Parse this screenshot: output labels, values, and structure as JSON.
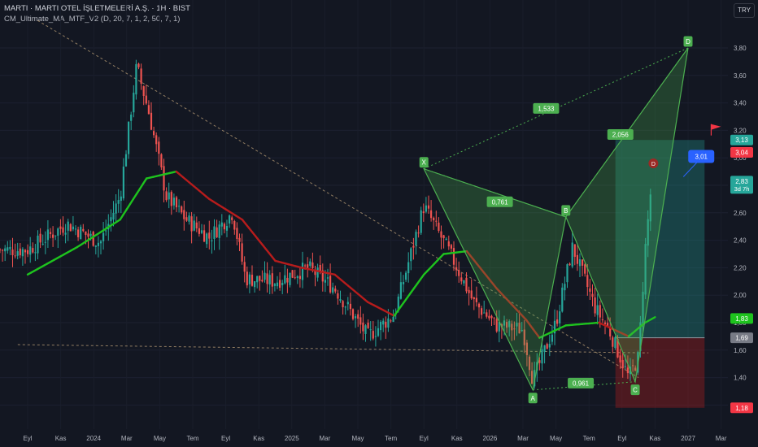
{
  "header": {
    "title": "MARTI · MARTI OTEL İŞLETMELERİ A.Ş. · 1H · BIST",
    "indicator": "CM_Ultimate_MA_MTF_V2 (D, 20, 7, 1, 2, 50, 7, 1)"
  },
  "currency_button": "TRY",
  "colors": {
    "background": "#131722",
    "bull": "#26a69a",
    "bear": "#ef5350",
    "ma_up": "#1ec31e",
    "ma_down": "#b71c1c",
    "pattern": "#4caf50",
    "target_box": "#26a69a",
    "stop_box": "#b71c1c"
  },
  "chart_data": {
    "type": "candlestick",
    "y_axis": {
      "ticks": [
        "3,80",
        "3,60",
        "3,40",
        "3,20",
        "3,00",
        "2,80",
        "2,60",
        "2,40",
        "2,20",
        "2,00",
        "1,80",
        "1,60",
        "1,40",
        "1,20"
      ],
      "range": [
        1.12,
        3.92
      ]
    },
    "x_axis": {
      "labels": [
        "Eyl",
        "Kas",
        "2024",
        "Mar",
        "May",
        "Tem",
        "Eyl",
        "Kas",
        "2025",
        "Mar",
        "May",
        "Tem",
        "Eyl",
        "Kas",
        "2026",
        "Mar",
        "May",
        "Tem",
        "Eyl",
        "Kas",
        "2027",
        "Mar"
      ]
    },
    "price_path": [
      {
        "t": 0,
        "p": 2.33
      },
      {
        "t": 1.2,
        "p": 2.52
      },
      {
        "t": 2.2,
        "p": 2.38
      },
      {
        "t": 2.8,
        "p": 2.72
      },
      {
        "t": 3.3,
        "p": 3.67
      },
      {
        "t": 3.7,
        "p": 3.3
      },
      {
        "t": 4.2,
        "p": 2.72
      },
      {
        "t": 4.8,
        "p": 2.55
      },
      {
        "t": 5.5,
        "p": 2.42
      },
      {
        "t": 6.2,
        "p": 2.6
      },
      {
        "t": 6.6,
        "p": 2.12
      },
      {
        "t": 7.5,
        "p": 2.1
      },
      {
        "t": 8.5,
        "p": 2.2
      },
      {
        "t": 9.3,
        "p": 2.05
      },
      {
        "t": 10.3,
        "p": 1.7
      },
      {
        "t": 11.1,
        "p": 1.86
      },
      {
        "t": 12.0,
        "p": 2.65
      },
      {
        "t": 12.8,
        "p": 2.3
      },
      {
        "t": 13.5,
        "p": 1.95
      },
      {
        "t": 14.2,
        "p": 1.78
      },
      {
        "t": 15.0,
        "p": 1.75
      },
      {
        "t": 15.3,
        "p": 1.38
      },
      {
        "t": 16.0,
        "p": 1.8
      },
      {
        "t": 16.5,
        "p": 2.35
      },
      {
        "t": 17.2,
        "p": 1.9
      },
      {
        "t": 17.6,
        "p": 1.75
      },
      {
        "t": 18.2,
        "p": 1.4
      },
      {
        "t": 18.5,
        "p": 1.55
      },
      {
        "t": 18.7,
        "p": 2.33
      },
      {
        "t": 18.9,
        "p": 2.83
      }
    ],
    "moving_average": [
      {
        "t": 0,
        "p": 2.15
      },
      {
        "t": 1.5,
        "p": 2.35
      },
      {
        "t": 2.8,
        "p": 2.55
      },
      {
        "t": 3.6,
        "p": 2.85
      },
      {
        "t": 4.5,
        "p": 2.9
      },
      {
        "t": 5.5,
        "p": 2.7
      },
      {
        "t": 6.5,
        "p": 2.55
      },
      {
        "t": 7.5,
        "p": 2.25
      },
      {
        "t": 8.3,
        "p": 2.2
      },
      {
        "t": 9.3,
        "p": 2.15
      },
      {
        "t": 10.3,
        "p": 1.95
      },
      {
        "t": 11.1,
        "p": 1.85
      },
      {
        "t": 12.0,
        "p": 2.15
      },
      {
        "t": 12.6,
        "p": 2.3
      },
      {
        "t": 13.3,
        "p": 2.32
      },
      {
        "t": 14.2,
        "p": 2.05
      },
      {
        "t": 15.1,
        "p": 1.82
      },
      {
        "t": 15.5,
        "p": 1.69
      },
      {
        "t": 16.3,
        "p": 1.78
      },
      {
        "t": 17.3,
        "p": 1.8
      },
      {
        "t": 18.2,
        "p": 1.7
      },
      {
        "t": 18.7,
        "p": 1.8
      },
      {
        "t": 19.0,
        "p": 1.84
      }
    ],
    "pattern_points": [
      {
        "label": "X",
        "t": 12.0,
        "p": 2.92
      },
      {
        "label": "A",
        "t": 15.3,
        "p": 1.31
      },
      {
        "label": "B",
        "t": 16.3,
        "p": 2.57
      },
      {
        "label": "C",
        "t": 18.4,
        "p": 1.37
      },
      {
        "label": "D",
        "t": 20.0,
        "p": 3.8
      }
    ],
    "ratios": [
      {
        "label": "0,761",
        "t": 14.3,
        "p": 2.68
      },
      {
        "label": "0,961",
        "t": 16.75,
        "p": 1.36
      },
      {
        "label": "1,533",
        "t": 15.7,
        "p": 3.36
      },
      {
        "label": "2,056",
        "t": 17.95,
        "p": 3.17
      }
    ],
    "d_marker": {
      "label": "D",
      "t": 18.95,
      "p": 2.96
    },
    "target_callout": {
      "label": "3,01",
      "t": 20.4,
      "p": 3.01
    },
    "trendlines": [
      {
        "from": {
          "t": 0.3,
          "p": 4.0
        },
        "to": {
          "t": 18.5,
          "p": 1.4
        }
      },
      {
        "from": {
          "t": -0.3,
          "p": 1.64
        },
        "to": {
          "t": 18.8,
          "p": 1.58
        }
      }
    ],
    "position": {
      "start_t": 17.8,
      "end_t": 20.5,
      "entry": 1.69,
      "target": 3.13,
      "stop": 1.18
    },
    "price_labels": [
      {
        "text": "3,13",
        "p": 3.13,
        "bg": "#26a69a"
      },
      {
        "text": "3,04",
        "p": 3.04,
        "bg": "#f23645"
      },
      {
        "text": "2,83",
        "sub": "3d 7h",
        "p": 2.83,
        "bg": "#26a69a"
      },
      {
        "text": "1,83",
        "p": 1.83,
        "bg": "#1ec31e"
      },
      {
        "text": "1,69",
        "p": 1.69,
        "bg": "#787b86"
      },
      {
        "text": "1,18",
        "p": 1.18,
        "bg": "#f23645"
      }
    ],
    "flag_p": 3.21
  }
}
